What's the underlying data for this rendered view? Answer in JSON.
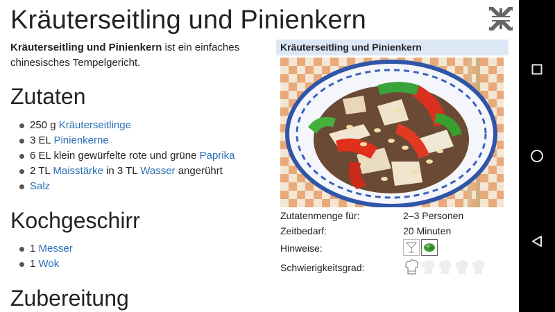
{
  "article": {
    "title": "Kräuterseitling und Pinienkern",
    "intro_bold": "Kräuterseitling und Pinienkern",
    "intro_rest": " ist ein einfaches chinesisches Tempelgericht."
  },
  "sections": {
    "zutaten": {
      "heading": "Zutaten",
      "items": [
        {
          "pre": "250 g ",
          "link": "Kräuterseitlinge",
          "post": ""
        },
        {
          "pre": "3 EL ",
          "link": "Pinienkerne",
          "post": ""
        },
        {
          "pre": "6 EL klein gewürfelte rote und grüne ",
          "link": "Paprika",
          "post": ""
        },
        {
          "pre": "2 TL ",
          "link": "Maisstärke",
          "mid": " in 3 TL ",
          "link2": "Wasser",
          "post": " angerührt"
        },
        {
          "pre": "",
          "link": "Salz",
          "post": ""
        }
      ]
    },
    "kochgeschirr": {
      "heading": "Kochgeschirr",
      "items": [
        {
          "pre": "1 ",
          "link": "Messer"
        },
        {
          "pre": "1 ",
          "link": "Wok"
        }
      ]
    },
    "zubereitung": {
      "heading": "Zubereitung"
    }
  },
  "infobox": {
    "header": "Kräuterseitling und Pinienkern",
    "rows": [
      {
        "label": "Zutatenmenge für:",
        "value": "2–3 Personen"
      },
      {
        "label": "Zeitbedarf:",
        "value": "20 Minuten"
      },
      {
        "label": "Hinweise:"
      },
      {
        "label": "Schwierigkeitsgrad:"
      }
    ],
    "hint_icons": [
      "cocktail-glass-icon",
      "vegetarian-icon"
    ],
    "difficulty": 1,
    "difficulty_max": 5
  },
  "colors": {
    "link": "#2a6db5",
    "infobox_header_bg": "#dde8f7",
    "navbar_bg": "#000000"
  }
}
